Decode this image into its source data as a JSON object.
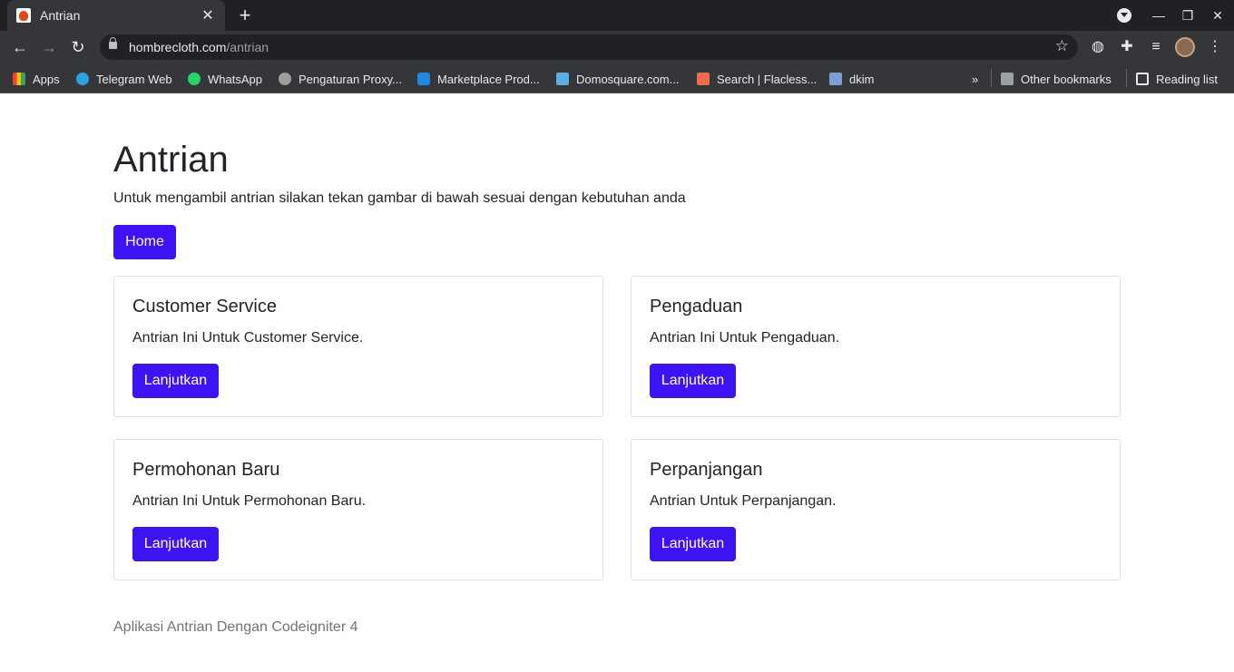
{
  "browser": {
    "tab_title": "Antrian",
    "url_host": "hombrecloth.com",
    "url_path": "/antrian",
    "bookmarks": [
      {
        "label": "Apps",
        "color": "#4285f4"
      },
      {
        "label": "Telegram Web",
        "color": "#2aa3e0"
      },
      {
        "label": "WhatsApp",
        "color": "#25d366"
      },
      {
        "label": "Pengaturan Proxy...",
        "color": "#9e9e9e"
      },
      {
        "label": "Marketplace Prod...",
        "color": "#1e88e5"
      },
      {
        "label": "Domosquare.com...",
        "color": "#5dade2"
      },
      {
        "label": "Search | Flacless...",
        "color": "#ef6c4a"
      },
      {
        "label": "dkim",
        "color": "#7aa0d6"
      }
    ],
    "other_bookmarks": "Other bookmarks",
    "reading_list": "Reading list",
    "icons": {
      "back": "arrow-left-icon",
      "forward": "arrow-right-icon",
      "reload": "reload-icon",
      "bookmark_star": "star-icon",
      "extensions": "puzzle-icon",
      "menu": "kebab-icon"
    }
  },
  "page": {
    "title": "Antrian",
    "lead": "Untuk mengambil antrian silakan tekan gambar di bawah sesuai dengan kebutuhan anda",
    "home_label": "Home",
    "cards": [
      {
        "title": "Customer Service",
        "text": "Antrian Ini Untuk Customer Service.",
        "button": "Lanjutkan"
      },
      {
        "title": "Pengaduan",
        "text": "Antrian Ini Untuk Pengaduan.",
        "button": "Lanjutkan"
      },
      {
        "title": "Permohonan Baru",
        "text": "Antrian Ini Untuk Permohonan Baru.",
        "button": "Lanjutkan"
      },
      {
        "title": "Perpanjangan",
        "text": "Antrian Untuk Perpanjangan.",
        "button": "Lanjutkan"
      }
    ],
    "footer": "Aplikasi Antrian Dengan Codeigniter 4",
    "accent_color": "#3d13f5"
  }
}
